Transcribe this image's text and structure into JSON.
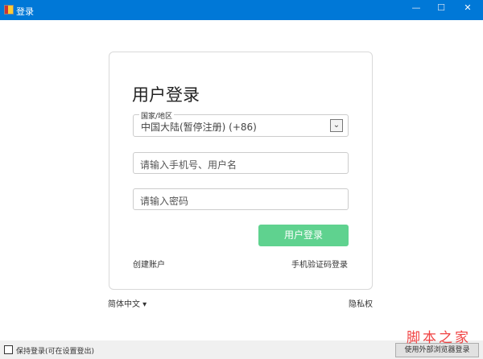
{
  "window": {
    "title": "登录",
    "minimize": "—",
    "maximize": "☐",
    "close": "✕"
  },
  "login": {
    "heading": "用户登录",
    "country_label": "国家/地区",
    "country_value": "中国大陆(暂停注册) (+86)",
    "phone_placeholder": "请输入手机号、用户名",
    "password_placeholder": "请输入密码",
    "login_button": "用户登录",
    "create_account": "创建账户",
    "sms_login": "手机验证码登录"
  },
  "language": "简体中文 ▾",
  "privacy": "隐私权",
  "footer": {
    "keep_login": "保持登录(可在设置登出)",
    "external_browser": "使用外部浏览器登录"
  },
  "watermark": "脚本之家"
}
